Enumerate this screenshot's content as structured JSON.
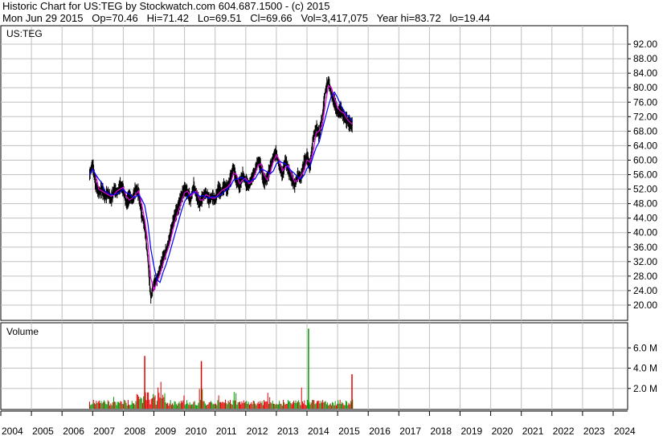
{
  "header": {
    "line1": "Historic Chart for US:TEG by Stockwatch.com 604.687.1500 - (c) 2015",
    "line2": "Mon Jun 29 2015   Op=70.46   Hi=71.42   Lo=69.51   Cl=69.66   Vol=3,417,075   Year hi=83.72   lo=19.44"
  },
  "chart_data": [
    {
      "type": "line",
      "title": "US:TEG",
      "ylim": [
        16,
        96
      ],
      "y_ticks": [
        "92.00",
        "88.00",
        "84.00",
        "80.00",
        "76.00",
        "72.00",
        "68.00",
        "64.00",
        "60.00",
        "56.00",
        "52.00",
        "48.00",
        "44.00",
        "40.00",
        "36.00",
        "32.00",
        "28.00",
        "24.00",
        "20.00"
      ],
      "x_ticks": [
        "2004",
        "2005",
        "2006",
        "2007",
        "2008",
        "2009",
        "2010",
        "2011",
        "2012",
        "2013",
        "2014",
        "2015",
        "2016",
        "2017",
        "2018",
        "2019",
        "2020",
        "2021",
        "2022",
        "2023",
        "2024"
      ],
      "grid": true,
      "colors": {
        "price": "#000000",
        "ma_short": "#e000e0",
        "ma_long": "#0000ff"
      },
      "series": [
        {
          "x": [
            2006.9,
            2007.0,
            2007.1,
            2007.2,
            2007.3,
            2007.4,
            2007.5,
            2007.6,
            2007.7,
            2007.8,
            2007.9,
            2008.0,
            2008.1,
            2008.2,
            2008.3,
            2008.4,
            2008.5,
            2008.6,
            2008.7,
            2008.8,
            2008.9,
            2009.0,
            2009.1,
            2009.2,
            2009.3,
            2009.4,
            2009.5,
            2009.6,
            2009.7,
            2009.8,
            2009.9,
            2010.0,
            2010.1,
            2010.2,
            2010.3,
            2010.4,
            2010.5,
            2010.6,
            2010.7,
            2010.8,
            2010.9,
            2011.0,
            2011.1,
            2011.2,
            2011.3,
            2011.4,
            2011.5,
            2011.6,
            2011.7,
            2011.8,
            2011.9,
            2012.0,
            2012.1,
            2012.2,
            2012.3,
            2012.4,
            2012.5,
            2012.6,
            2012.7,
            2012.8,
            2012.9,
            2013.0,
            2013.1,
            2013.2,
            2013.3,
            2013.4,
            2013.5,
            2013.6,
            2013.7,
            2013.8,
            2013.9,
            2014.0,
            2014.1,
            2014.2,
            2014.3,
            2014.4,
            2014.5,
            2014.6,
            2014.7,
            2014.8,
            2014.9,
            2015.0,
            2015.1,
            2015.2,
            2015.3,
            2015.4,
            2015.49
          ],
          "values": [
            56,
            59,
            53,
            51,
            52,
            50,
            51,
            49,
            52,
            51,
            53,
            52,
            48,
            50,
            49,
            52,
            51,
            45,
            42,
            33,
            22,
            26,
            27,
            30,
            33,
            35,
            38,
            42,
            45,
            47,
            50,
            52,
            51,
            49,
            53,
            50,
            48,
            50,
            51,
            49,
            50,
            49,
            52,
            51,
            53,
            52,
            55,
            58,
            54,
            53,
            56,
            54,
            53,
            55,
            57,
            60,
            58,
            54,
            55,
            58,
            61,
            62,
            58,
            56,
            60,
            57,
            55,
            53,
            56,
            55,
            59,
            61,
            58,
            66,
            69,
            67,
            72,
            79,
            82,
            78,
            76,
            73,
            74,
            72,
            71,
            70,
            69.66
          ]
        },
        {
          "type": "bar",
          "ylabel": "Volume",
          "ylim": [
            0,
            8
          ],
          "y_ticks": [
            "6.0 M",
            "4.0 M",
            "2.0 M"
          ],
          "colors": {
            "up": "#009900",
            "down": "#e00000"
          },
          "spikes": [
            {
              "x": 2008.7,
              "value": 5.2
            },
            {
              "x": 2010.55,
              "value": 4.7
            },
            {
              "x": 2014.05,
              "value": 7.9
            },
            {
              "x": 2015.47,
              "value": 3.4
            }
          ]
        }
      ]
    }
  ]
}
